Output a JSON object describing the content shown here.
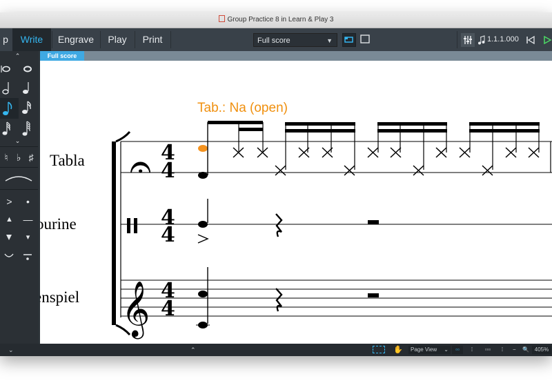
{
  "window": {
    "title": "Group Practice 8 in Learn & Play 3"
  },
  "toolbar": {
    "modes": [
      {
        "label": "p",
        "active": false
      },
      {
        "label": "Write",
        "active": true
      },
      {
        "label": "Engrave",
        "active": false
      },
      {
        "label": "Play",
        "active": false
      },
      {
        "label": "Print",
        "active": false
      }
    ],
    "layout_select": "Full score",
    "position": "1.1.1.000"
  },
  "tabs": {
    "active": "Full score"
  },
  "score": {
    "annotation": "Tab.: Na (open)",
    "instruments": [
      "Tabla",
      "ourine",
      "enspiel"
    ],
    "time_signature": {
      "numerator": "4",
      "denominator": "4"
    }
  },
  "statusbar": {
    "view": "Page View",
    "zoom": "405%"
  },
  "colors": {
    "accent": "#35b6f0",
    "tab_active": "#3fa9e3",
    "annotation": "#f0900f",
    "toolbar": "#394149",
    "panel": "#2b3035"
  }
}
